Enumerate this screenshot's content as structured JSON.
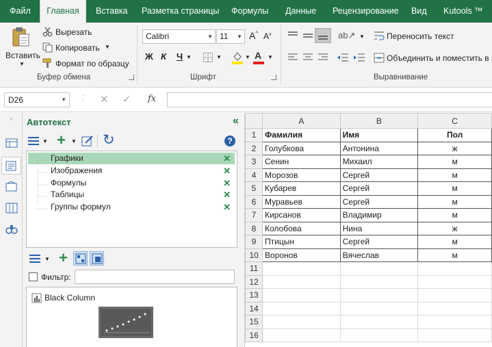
{
  "tabs": [
    "Файл",
    "Главная",
    "Вставка",
    "Разметка страницы",
    "Формулы",
    "Данные",
    "Рецензирование",
    "Вид",
    "Kutools ™"
  ],
  "active_tab": "Главная",
  "ribbon": {
    "clipboard": {
      "paste": "Вставить",
      "cut": "Вырезать",
      "copy": "Копировать",
      "format_painter": "Формат по образцу",
      "label": "Буфер обмена"
    },
    "font": {
      "name": "Calibri",
      "size": "11",
      "bold": "Ж",
      "italic": "К",
      "underline": "Ч",
      "label": "Шрифт"
    },
    "alignment": {
      "wrap": "Переносить текст",
      "merge": "Объединить и поместить в ц",
      "label": "Выравнивание"
    }
  },
  "formula_bar": {
    "name_box": "D26",
    "fx": "fx",
    "value": ""
  },
  "pane": {
    "title": "Автотекст",
    "collapse": "«",
    "tree": [
      {
        "label": "Графики",
        "selected": true
      },
      {
        "label": "Изображения",
        "selected": false
      },
      {
        "label": "Формулы",
        "selected": false
      },
      {
        "label": "Таблицы",
        "selected": false
      },
      {
        "label": "Группы формул",
        "selected": false
      }
    ],
    "filter_label": "Фильтр:",
    "entry_title": "Black Column",
    "delete_glyph": "✕"
  },
  "sheet": {
    "columns": [
      "A",
      "B",
      "C"
    ],
    "rows": [
      {
        "n": "1",
        "a": "Фамилия",
        "b": "Имя",
        "c": "Пол"
      },
      {
        "n": "2",
        "a": "Голубкова",
        "b": "Антонина",
        "c": "ж"
      },
      {
        "n": "3",
        "a": "Сенин",
        "b": "Михаил",
        "c": "м"
      },
      {
        "n": "4",
        "a": "Морозов",
        "b": "Сергей",
        "c": "м"
      },
      {
        "n": "5",
        "a": "Кубарев",
        "b": "Сергей",
        "c": "м"
      },
      {
        "n": "6",
        "a": "Муравьев",
        "b": "Сергей",
        "c": "м"
      },
      {
        "n": "7",
        "a": "Кирсанов",
        "b": "Владимир",
        "c": "м"
      },
      {
        "n": "8",
        "a": "Колобова",
        "b": "Нина",
        "c": "ж"
      },
      {
        "n": "9",
        "a": "Птицын",
        "b": "Сергей",
        "c": "м"
      },
      {
        "n": "10",
        "a": "Воронов",
        "b": "Вячеслав",
        "c": "м"
      },
      {
        "n": "11",
        "a": "",
        "b": "",
        "c": ""
      },
      {
        "n": "12",
        "a": "",
        "b": "",
        "c": ""
      },
      {
        "n": "13",
        "a": "",
        "b": "",
        "c": ""
      },
      {
        "n": "14",
        "a": "",
        "b": "",
        "c": ""
      },
      {
        "n": "15",
        "a": "",
        "b": "",
        "c": ""
      },
      {
        "n": "16",
        "a": "",
        "b": "",
        "c": ""
      }
    ]
  },
  "colors": {
    "brand": "#217346",
    "selected_item": "#a9d8b8",
    "delete": "#2a8a4e"
  }
}
